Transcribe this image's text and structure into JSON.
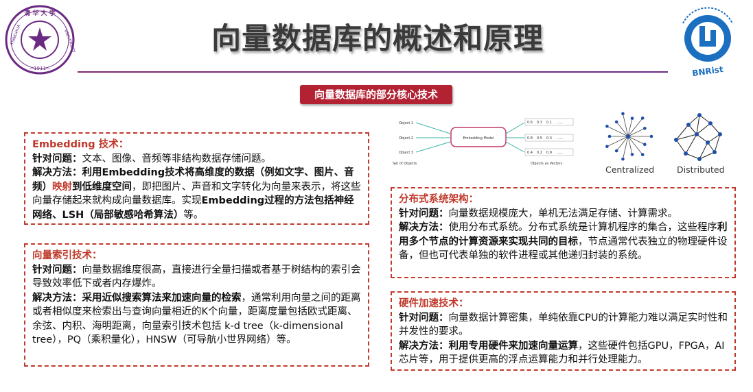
{
  "title": "向量数据库的概述和原理",
  "subtitle": "向量数据库的部分核心技术",
  "colors": {
    "accent_red": "#c0392b",
    "badge_red": "#b22233",
    "rule_purple": "#6a2a86",
    "logo_purple": "#6b2a82",
    "logo_blue": "#1a6fc0"
  },
  "logos": {
    "left": {
      "name": "tsinghua-university-seal",
      "text": "清华大学 TSINGHUA UNIVERSITY 1911"
    },
    "right": {
      "name": "bnrist-logo",
      "text": "BNRist"
    }
  },
  "diagram": {
    "inputs": [
      "Object 1",
      "Object 2",
      "Object 3"
    ],
    "inputs_caption": "Set of Objects",
    "model": "Embedding Model",
    "vectors": [
      [
        "0.6",
        "0.3",
        "0.1",
        "......"
      ],
      [
        "0.8",
        "0.5",
        "0.3",
        "......"
      ],
      [
        "0.4",
        "0.2",
        "0.9",
        "......"
      ]
    ],
    "vectors_caption": "Objects as Vectors",
    "centralized": "Centralized",
    "distributed": "Distributed"
  },
  "embedding": {
    "heading": "Embedding 技术：",
    "problem_label": "针对问题：",
    "problem": "文本、图像、音频等非结构数据存储问题。",
    "method_label": "解决方法：",
    "method_bold": "利用Embedding技术将高维度的数据（例如文字、图片、音频）",
    "method_red": "映射",
    "method_bold2": "到低维度空间",
    "method_rest": "，即把图片、声音和文字转化为向量来表示，将这些向量存储起来就构成向量数据库。实现",
    "method_bold3": "Embedding过程的方法包括神经网络、LSH（局部敏感哈希算法）",
    "method_end": "等。"
  },
  "index": {
    "heading": "向量索引技术：",
    "problem_label": "针对问题：",
    "problem": "向量数据维度很高，直接进行全量扫描或者基于树结构的索引会导致效率低下或者内存爆炸。",
    "method_label": "解决方法：",
    "method_bold": "采用近似搜索算法来加速向量的检索",
    "method_rest": "，通常利用向量之间的距离或者相似度来检索出与查询向量相近的K个向量，距离度量包括欧式距离、余弦、内积、海明距离，向量索引技术包括 k-d tree（k-dimensional tree），PQ（乘积量化），HNSW（可导航小世界网络）等。"
  },
  "distributed": {
    "heading": "分布式系统架构：",
    "problem_label": "针对问题：",
    "problem": "向量数据规模庞大，单机无法满足存储、计算需求。",
    "method_label": "解决方法：",
    "method_a": "使用分布式系统。分布式系统是计算机程序的集合，这些程序",
    "method_bold": "利用多个节点的计算资源来实现共同的目标",
    "method_rest": "，节点通常代表独立的物理硬件设备，但也可代表单独的软件进程或其他递归封装的系统。"
  },
  "hardware": {
    "heading": "硬件加速技术：",
    "problem_label": "针对问题：",
    "problem": "向量数据计算密集，单纯依靠CPU的计算能力难以满足实时性和并发性的要求。",
    "method_label": "解决方法：",
    "method_bold": "利用专用硬件来加速向量运算",
    "method_rest": "，这些硬件包括GPU，FPGA，AI芯片等，用于提供更高的浮点运算能力和并行处理能力。"
  }
}
